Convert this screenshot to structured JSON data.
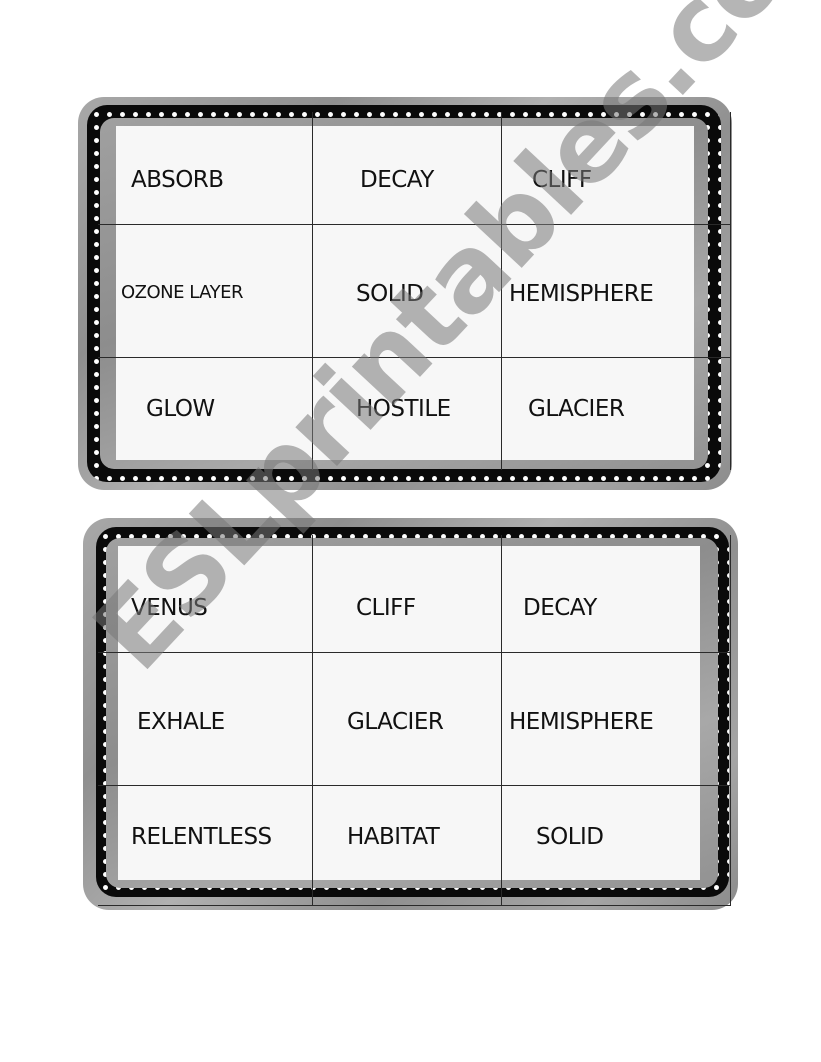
{
  "document": {
    "type": "bingo cards worksheet",
    "colors": {
      "frame_gray": "#9a9a9a",
      "dots_band": "#0a0a0a",
      "dot": "#ffffff",
      "cell_background": "#f7f7f7",
      "text": "#111111",
      "watermark": "#8a8a8a"
    }
  },
  "cards": [
    {
      "name": "card-1",
      "rows": [
        [
          "ABSORB",
          "DECAY",
          "CLIFF"
        ],
        [
          "OZONE LAYER",
          "SOLID",
          "HEMISPHERE"
        ],
        [
          "GLOW",
          "HOSTILE",
          "GLACIER"
        ]
      ]
    },
    {
      "name": "card-2",
      "rows": [
        [
          "VENUS",
          "CLIFF",
          "DECAY"
        ],
        [
          "EXHALE",
          "GLACIER",
          "HEMISPHERE"
        ],
        [
          "RELENTLESS",
          "HABITAT",
          "SOLID"
        ]
      ]
    }
  ],
  "watermark": {
    "text": "ESLprintables.com"
  }
}
